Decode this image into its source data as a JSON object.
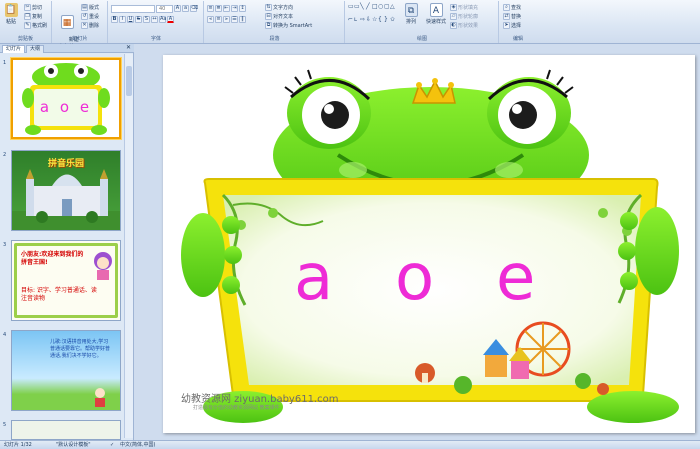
{
  "ribbon": {
    "clipboard": {
      "paste": "粘贴",
      "cut": "剪切",
      "copy": "复制",
      "format_painter": "格式刷",
      "label": "剪贴板"
    },
    "slides": {
      "new_slide": "新建\n幻灯片",
      "layout": "版式",
      "reset": "重设",
      "delete": "删除",
      "label": "幻灯片"
    },
    "font": {
      "font_size": "40",
      "label": "字体"
    },
    "paragraph": {
      "text_direction": "文字方向",
      "align_text": "对齐文本",
      "smartart": "转换为 SmartArt",
      "label": "段落"
    },
    "drawing": {
      "arrange": "排列",
      "quick_styles": "快速样式",
      "shape_fill": "形状填充",
      "shape_outline": "形状轮廓",
      "shape_effects": "形状效果",
      "label": "绘图"
    },
    "editing": {
      "find": "查找",
      "replace": "替换",
      "select": "选择",
      "label": "编辑"
    }
  },
  "panel": {
    "tabs": [
      "幻灯片",
      "大纲"
    ],
    "slides": [
      {
        "number": "1",
        "letters": "a o e"
      },
      {
        "number": "2",
        "title": "拼音乐园"
      },
      {
        "number": "3",
        "text1": "小朋友:欢迎来到我们的拼音王国!",
        "text2": "目标: 识字、学习普通话、读注音读物"
      },
      {
        "number": "4",
        "text": "儿歌:汉语拼音用处大,学习普通话要靠它。帮助学好普通话,我们决不学好它。"
      },
      {
        "number": "5"
      }
    ]
  },
  "slide": {
    "letters": [
      "a",
      "o",
      "e"
    ],
    "watermark": "幼教资源网 ziyuan.baby611.com",
    "watermark_sub": "打造最有价值的幼教资源网站  教案课件"
  },
  "status": {
    "slide_count": "幻灯片 1/32",
    "theme": "\"默认设计模板\"",
    "language": "中文(简体,中国)"
  },
  "colors": {
    "frog_green": "#6fdc1e",
    "frame_yellow": "#f5e20c",
    "letter_magenta": "#ee2bd6",
    "accent": "#f0a000"
  }
}
